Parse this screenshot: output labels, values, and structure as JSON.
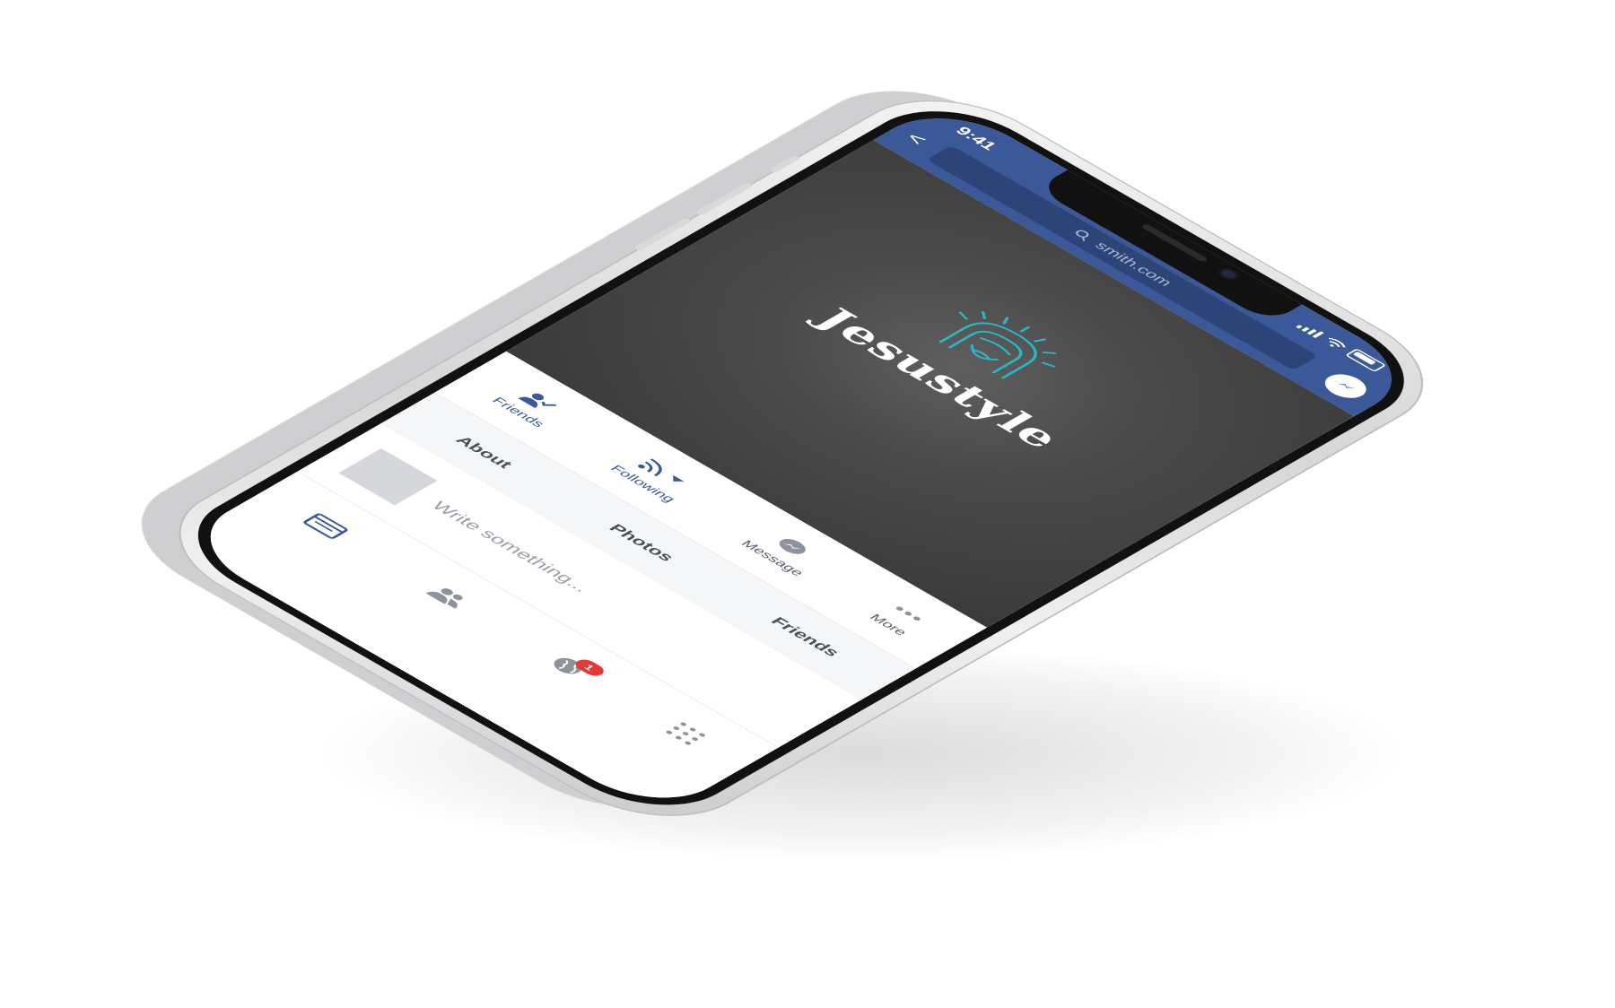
{
  "status": {
    "time": "9:41"
  },
  "browser": {
    "url": "smith.com",
    "back_glyph": "<"
  },
  "page": {
    "brand": "Jesustyle"
  },
  "actions": [
    {
      "label": "Friends",
      "icon": "friends-check-icon",
      "active": true
    },
    {
      "label": "Following",
      "icon": "rss-icon",
      "active": true
    },
    {
      "label": "Message",
      "icon": "messenger-icon",
      "active": false
    },
    {
      "label": "More",
      "icon": "more-icon",
      "active": false
    }
  ],
  "tabs": [
    {
      "label": "About"
    },
    {
      "label": "Photos"
    },
    {
      "label": "Friends"
    }
  ],
  "composer": {
    "placeholder": "Write something..."
  },
  "bottom_nav": [
    {
      "name": "news-feed",
      "icon": "feed-icon"
    },
    {
      "name": "friends",
      "icon": "people-icon"
    },
    {
      "name": "notifications",
      "icon": "globe-icon",
      "badge": "1"
    },
    {
      "name": "menu",
      "icon": "grid-icon"
    }
  ],
  "colors": {
    "facebook_blue": "#3b5998",
    "logo_teal": "#2ab7c7",
    "badge_red": "#e53935"
  }
}
